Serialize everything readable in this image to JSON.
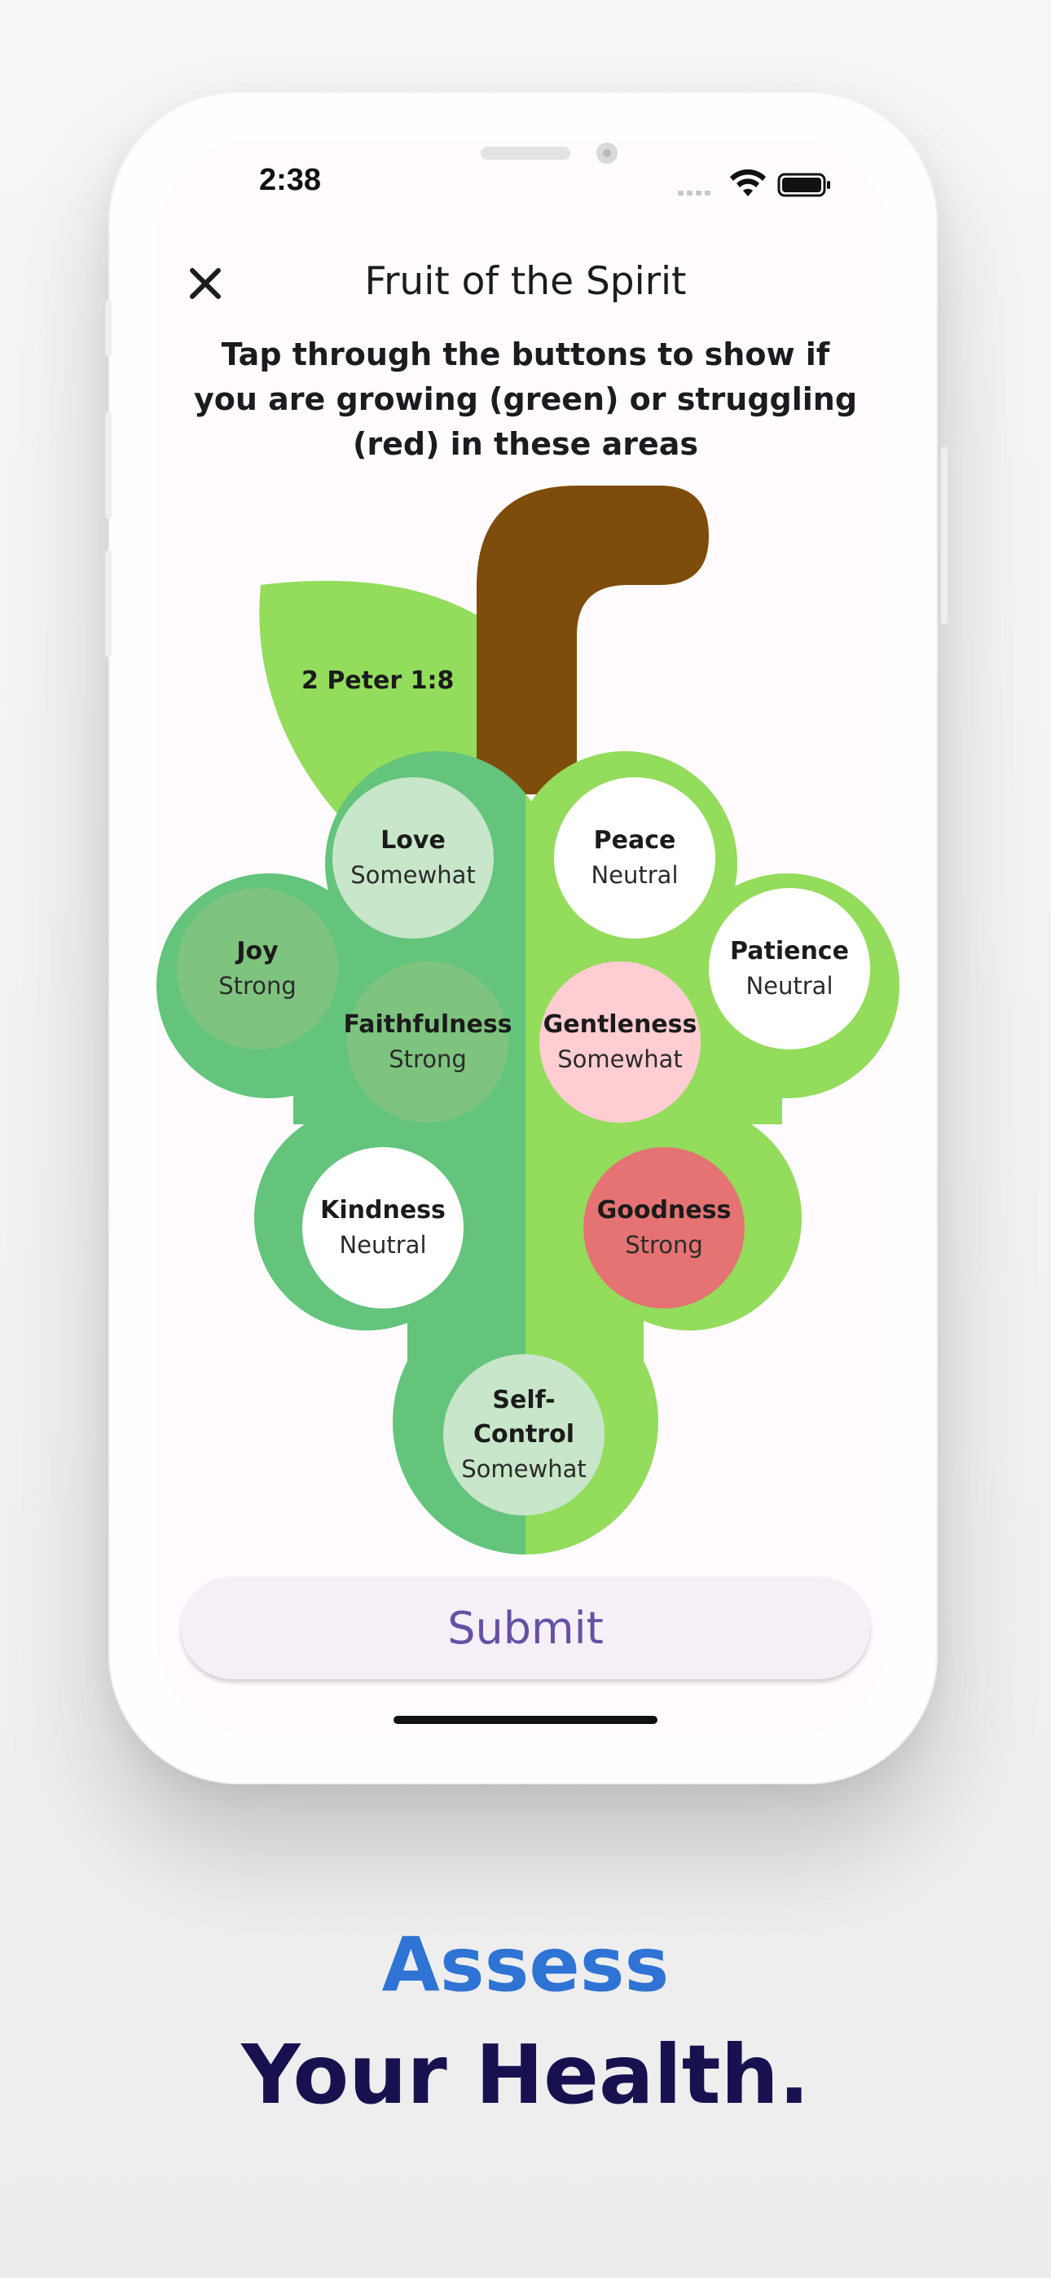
{
  "status_bar": {
    "time": "2:38"
  },
  "header": {
    "title": "Fruit of the Spirit"
  },
  "instructions": "Tap through the buttons to show if you are growing (green) or struggling (red) in these areas",
  "leaf_label": "2 Peter 1:8",
  "fruits": [
    {
      "name": "Love",
      "level": "Somewhat"
    },
    {
      "name": "Peace",
      "level": "Neutral"
    },
    {
      "name": "Joy",
      "level": "Strong"
    },
    {
      "name": "Patience",
      "level": "Neutral"
    },
    {
      "name": "Faithfulness",
      "level": "Strong"
    },
    {
      "name": "Gentleness",
      "level": "Somewhat"
    },
    {
      "name": "Kindness",
      "level": "Neutral"
    },
    {
      "name": "Goodness",
      "level": "Strong"
    },
    {
      "name": "Self-Control",
      "level": "Somewhat"
    }
  ],
  "submit_label": "Submit",
  "tagline": {
    "line1": "Assess",
    "line2": "Your Health."
  },
  "colors": {
    "grape_left": "#64c47c",
    "grape_right": "#93dc5c",
    "stem": "#7e4d0b",
    "leaf": "#93dc5c",
    "accent": "#6750a4",
    "tagline_blue": "#2f73d4",
    "tagline_navy": "#17124f"
  }
}
